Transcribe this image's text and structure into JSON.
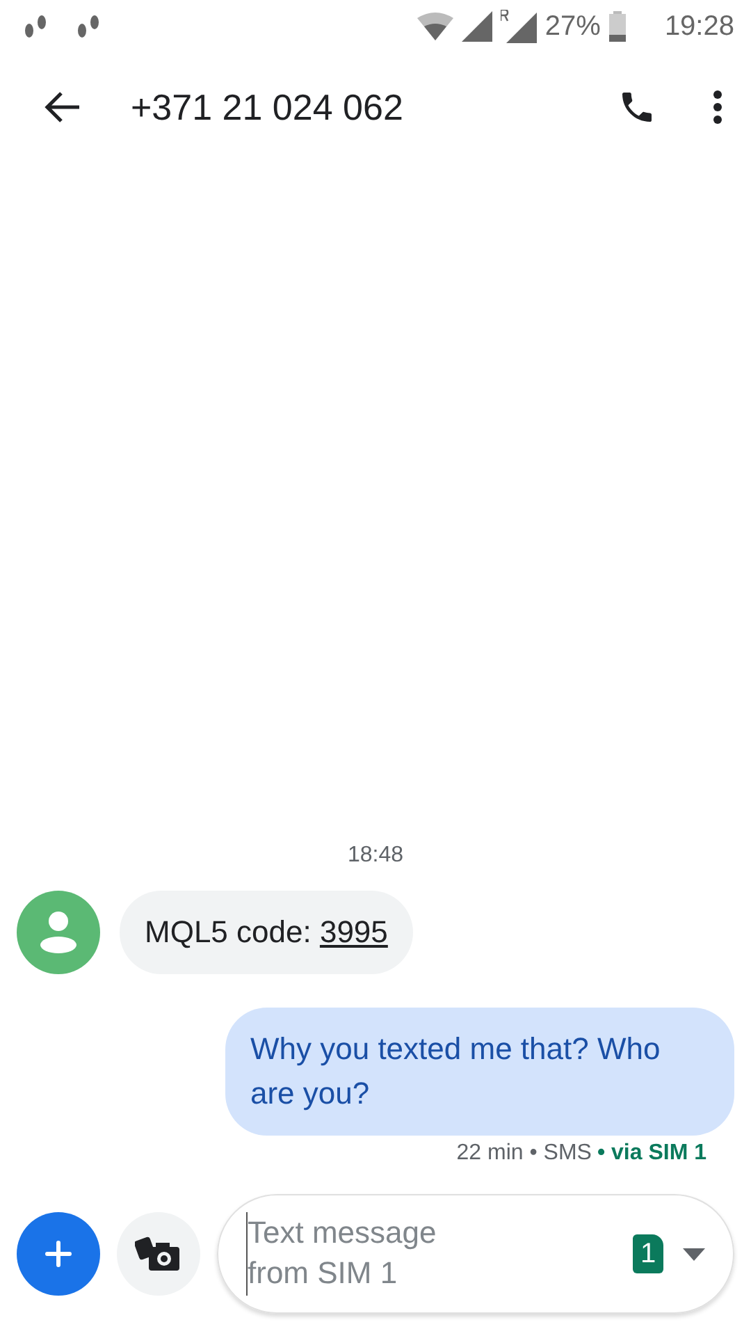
{
  "status_bar": {
    "battery": "27%",
    "time": "19:28"
  },
  "header": {
    "title": "+371 21 024 062"
  },
  "conversation": {
    "timestamp": "18:48",
    "messages": [
      {
        "kind": "incoming",
        "text": "MQL5 code: ",
        "link": "3995"
      },
      {
        "kind": "outgoing",
        "text": "Why you texted me that? Who are you?",
        "meta": "22 min • SMS",
        "sim": "• via SIM 1"
      }
    ]
  },
  "composer": {
    "placeholder": "Text message from SIM 1",
    "sim_badge": "1"
  }
}
